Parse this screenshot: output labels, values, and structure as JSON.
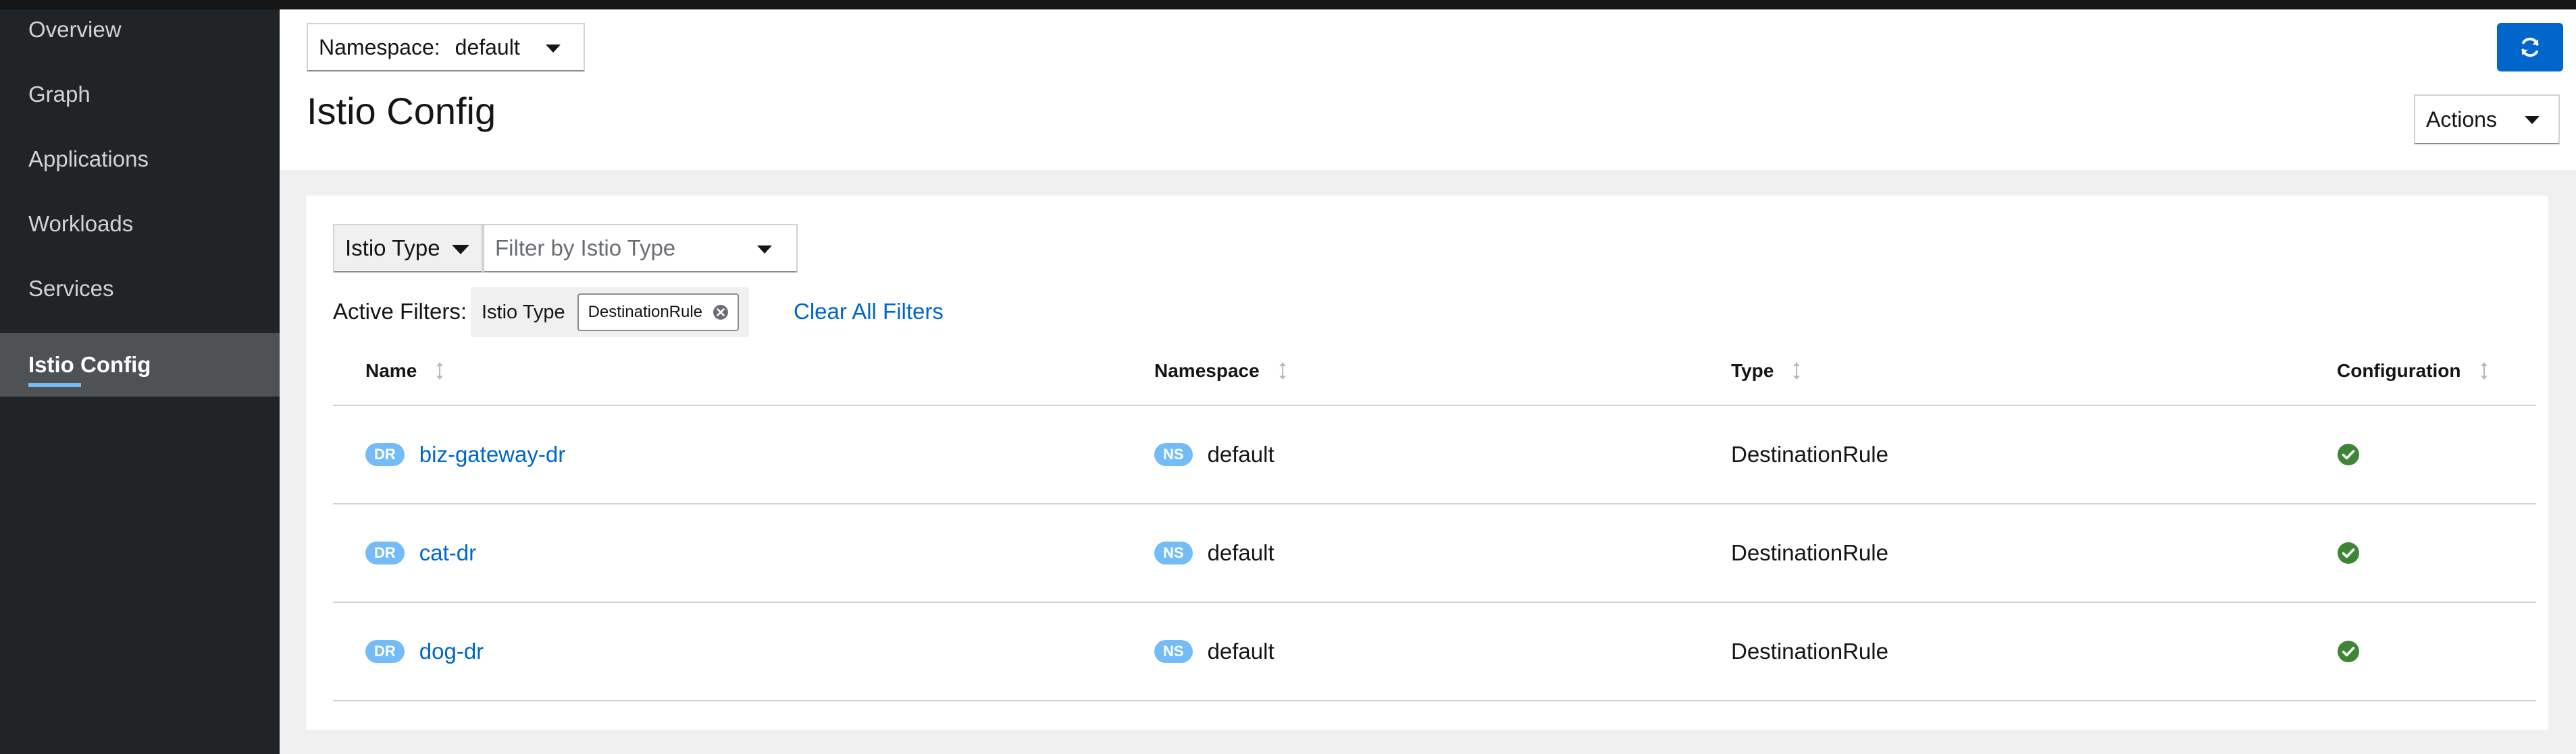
{
  "sidebar": {
    "items": [
      {
        "label": "Overview"
      },
      {
        "label": "Graph"
      },
      {
        "label": "Applications"
      },
      {
        "label": "Workloads"
      },
      {
        "label": "Services"
      },
      {
        "label": "Istio Config",
        "active": true
      }
    ]
  },
  "header": {
    "namespace_label": "Namespace:",
    "namespace_value": "default",
    "title": "Istio Config",
    "actions_label": "Actions",
    "refresh_icon": "refresh-icon"
  },
  "filters": {
    "type_select_label": "Istio Type",
    "filter_placeholder": "Filter by Istio Type",
    "active_filters_label": "Active Filters:",
    "chip_group_label": "Istio Type",
    "chips": [
      "DestinationRule"
    ],
    "clear_all_label": "Clear All Filters"
  },
  "table": {
    "columns": [
      "Name",
      "Namespace",
      "Type",
      "Configuration"
    ],
    "rows": [
      {
        "badge": "DR",
        "name": "biz-gateway-dr",
        "ns_badge": "NS",
        "namespace": "default",
        "type": "DestinationRule",
        "configuration": "valid"
      },
      {
        "badge": "DR",
        "name": "cat-dr",
        "ns_badge": "NS",
        "namespace": "default",
        "type": "DestinationRule",
        "configuration": "valid"
      },
      {
        "badge": "DR",
        "name": "dog-dr",
        "ns_badge": "NS",
        "namespace": "default",
        "type": "DestinationRule",
        "configuration": "valid"
      }
    ]
  },
  "colors": {
    "accent": "#0066cc",
    "sidebar_bg": "#212427",
    "badge": "#73bcf7",
    "valid": "#3e8635"
  }
}
